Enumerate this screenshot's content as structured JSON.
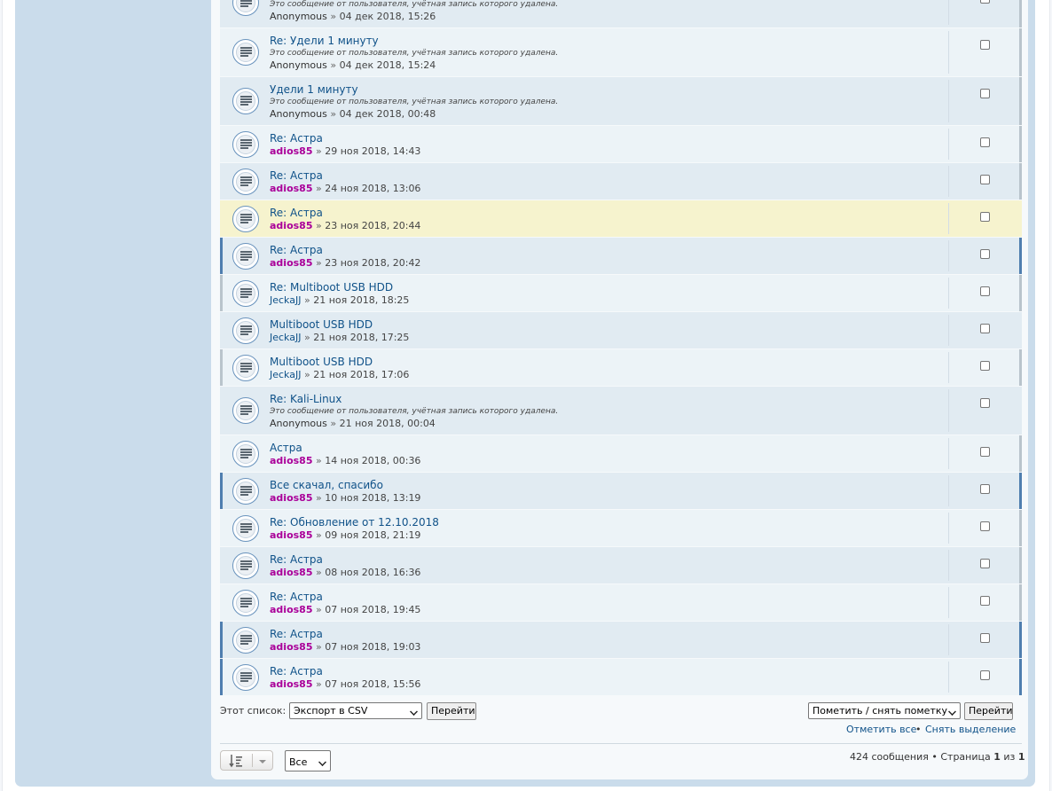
{
  "posts": [
    {
      "title": "",
      "note": "Это сообщение от пользователя, учётная запись которого удалена.",
      "author": "Anonymous",
      "sep": "»",
      "date": "04 дек 2018, 15:26"
    },
    {
      "title": "Re: Удели 1 минуту",
      "note": "Это сообщение от пользователя, учётная запись которого удалена.",
      "author": "Anonymous",
      "sep": "»",
      "date": "04 дек 2018, 15:24"
    },
    {
      "title": "Удели 1 минуту",
      "note": "Это сообщение от пользователя, учётная запись которого удалена.",
      "author": "Anonymous",
      "sep": "»",
      "date": "04 дек 2018, 00:48"
    },
    {
      "title": "Re: Астра",
      "author": "adios85",
      "sep": "»",
      "date": "29 ноя 2018, 14:43"
    },
    {
      "title": "Re: Астра",
      "author": "adios85",
      "sep": "»",
      "date": "24 ноя 2018, 13:06"
    },
    {
      "title": "Re: Астра",
      "author": "adios85",
      "sep": "»",
      "date": "23 ноя 2018, 20:44"
    },
    {
      "title": "Re: Астра",
      "author": "adios85",
      "sep": "»",
      "date": "23 ноя 2018, 20:42"
    },
    {
      "title": "Re: Multiboot USB HDD",
      "author": "JeckaJJ",
      "sep": "»",
      "date": "21 ноя 2018, 18:25"
    },
    {
      "title": "Multiboot USB HDD",
      "author": "JeckaJJ",
      "sep": "»",
      "date": "21 ноя 2018, 17:25"
    },
    {
      "title": "Multiboot USB HDD",
      "author": "JeckaJJ",
      "sep": "»",
      "date": "21 ноя 2018, 17:06"
    },
    {
      "title": "Re: Kali-Linux",
      "note": "Это сообщение от пользователя, учётная запись которого удалена.",
      "author": "Anonymous",
      "sep": "»",
      "date": "21 ноя 2018, 00:04"
    },
    {
      "title": "Астра",
      "author": "adios85",
      "sep": "»",
      "date": "14 ноя 2018, 00:36"
    },
    {
      "title": "Все скачал, спасибо",
      "author": "adios85",
      "sep": "»",
      "date": "10 ноя 2018, 13:19"
    },
    {
      "title": "Re: Обновление от 12.10.2018",
      "author": "adios85",
      "sep": "»",
      "date": "09 ноя 2018, 21:19"
    },
    {
      "title": "Re: Астра",
      "author": "adios85",
      "sep": "»",
      "date": "08 ноя 2018, 16:36"
    },
    {
      "title": "Re: Астра",
      "author": "adios85",
      "sep": "»",
      "date": "07 ноя 2018, 19:45"
    },
    {
      "title": "Re: Астра",
      "author": "adios85",
      "sep": "»",
      "date": "07 ноя 2018, 19:03"
    },
    {
      "title": "Re: Астра",
      "author": "adios85",
      "sep": "»",
      "date": "07 ноя 2018, 15:56"
    }
  ],
  "footer": {
    "list_label": "Этот список:",
    "export_select": "Экспорт в CSV",
    "go_button": "Перейти",
    "mark_select": "Пометить / снять пометку",
    "go_button_2": "Перейти",
    "mark_all": "Отметить все",
    "bullet": "•",
    "unmark_all": "Снять выделение",
    "count_text": "424 сообщения • Страница ",
    "page_current": "1",
    "page_of": " из ",
    "page_total": "1",
    "per_page_select": "Все"
  },
  "colors": {
    "link": "#105289",
    "moderator": "#aa0099",
    "highlight": "#f6f3ce",
    "accent_border": "#4f7eaf"
  },
  "icons": {
    "topic": "topic-read-icon",
    "sort": "sort-icon",
    "dropdown": "chevron-down-icon"
  }
}
